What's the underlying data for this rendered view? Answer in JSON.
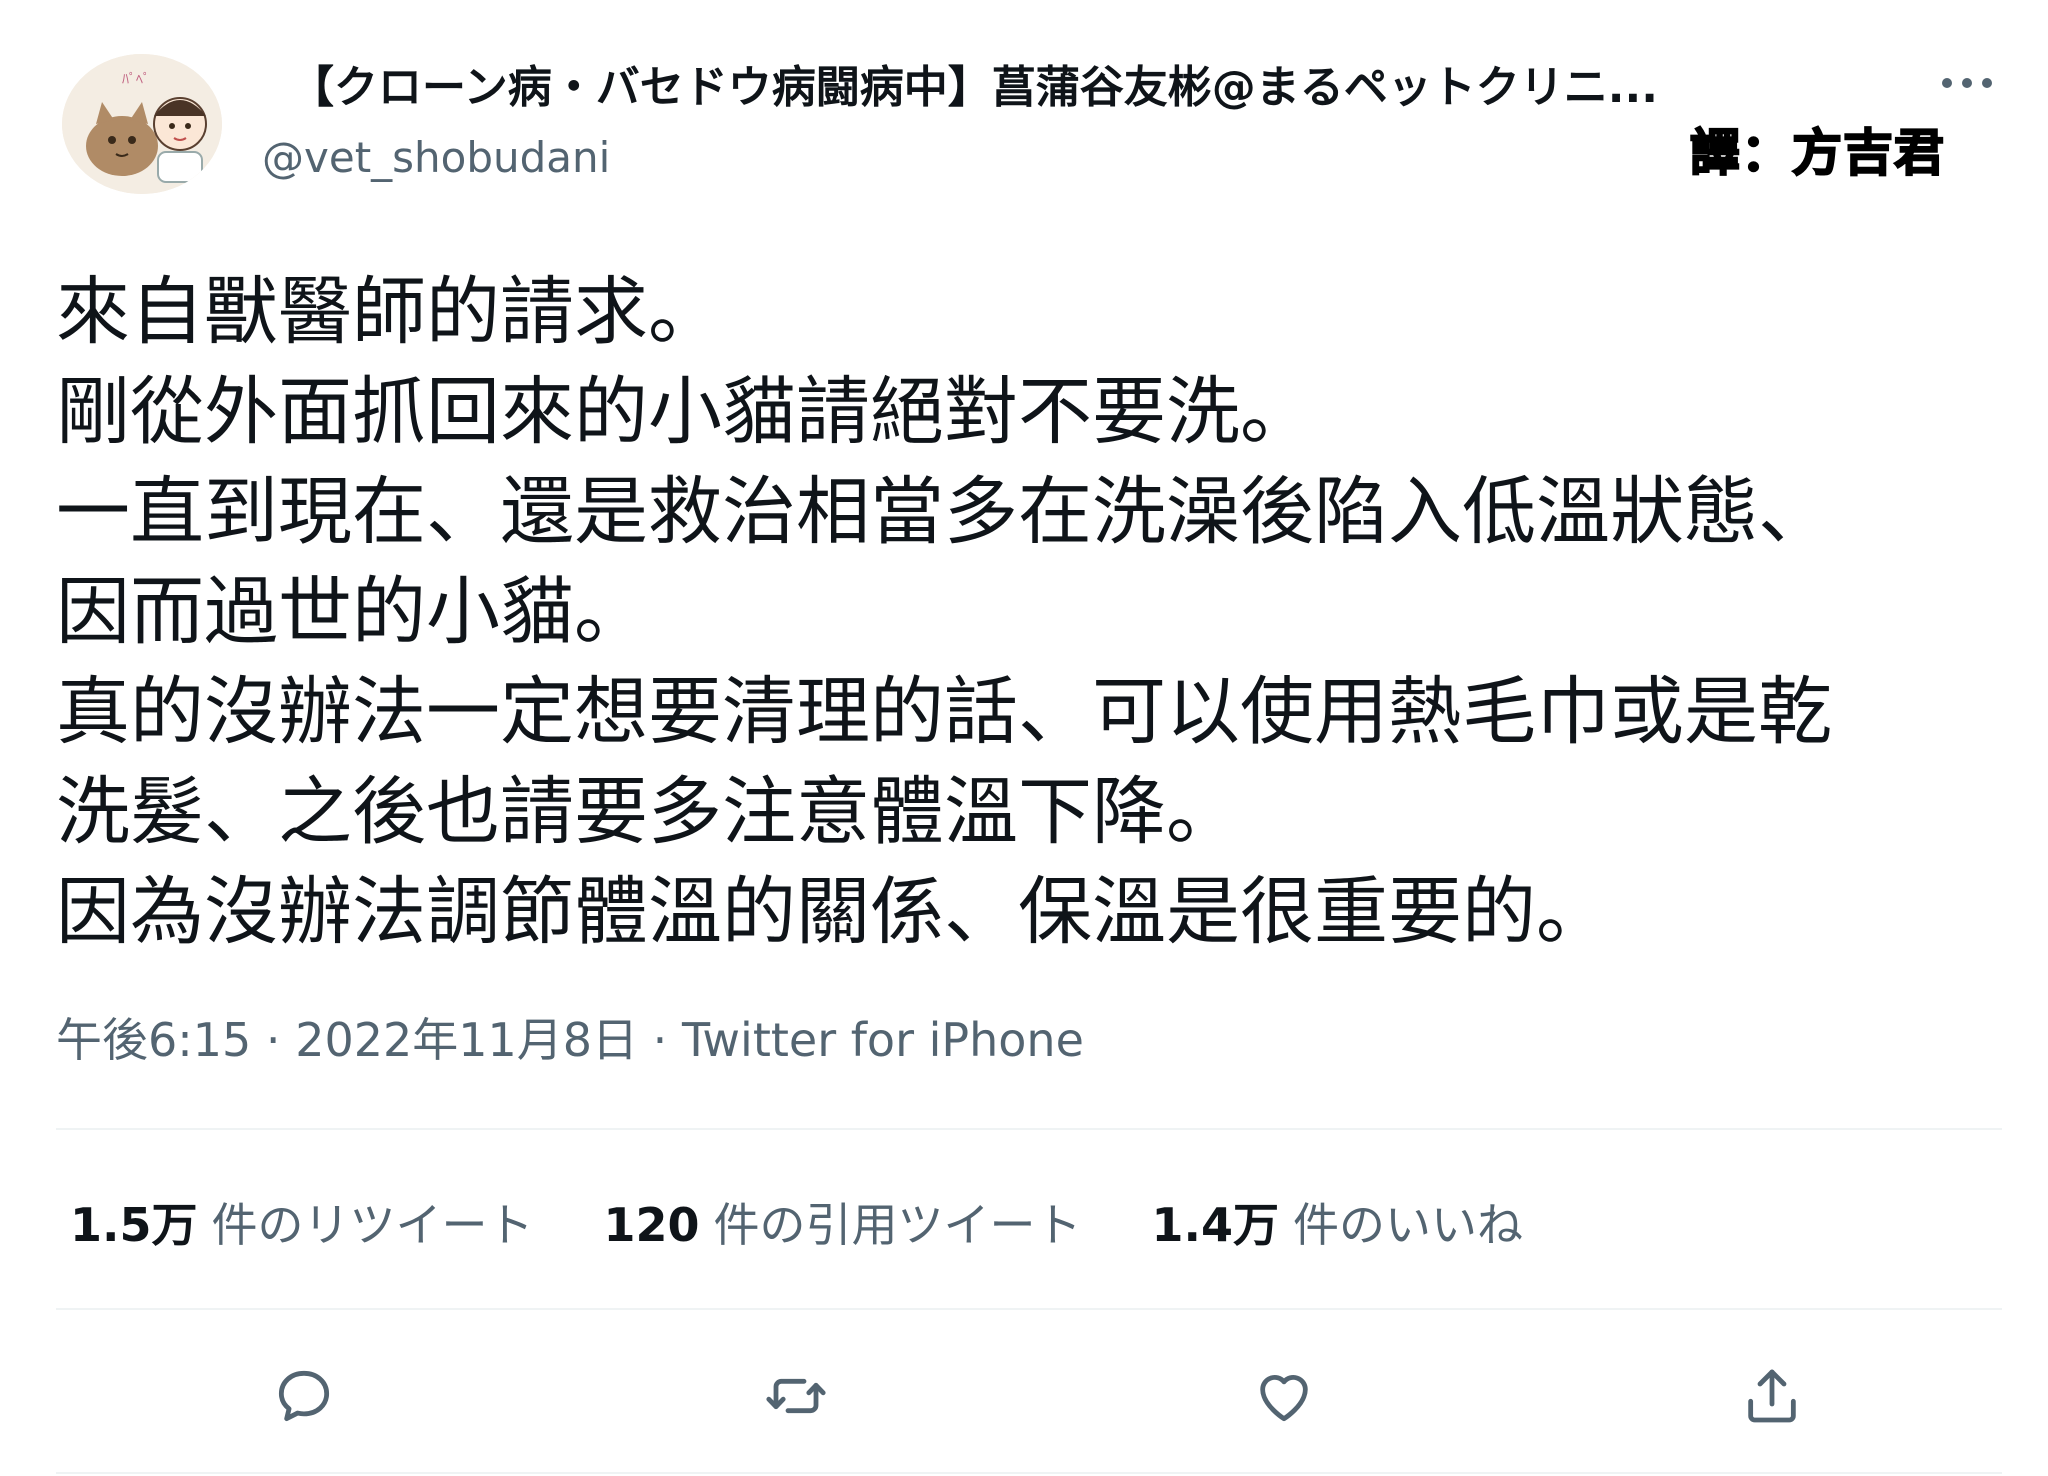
{
  "author": {
    "display_name": "【クローン病・バセドウ病闘病中】菖蒲谷友彬@まるペットクリニ...",
    "handle": "@vet_shobudani",
    "avatar_icon": "cat-doctor-avatar-icon"
  },
  "header": {
    "more_icon": "more-dots-icon",
    "watermark": "譯：方吉君"
  },
  "tweet": {
    "lines": [
      "來自獸醫師的請求。",
      "剛從外面抓回來的小貓請絕對不要洗。",
      "一直到現在、還是救治相當多在洗澡後陷入低溫狀態、",
      "因而過世的小貓。",
      "真的沒辦法一定想要清理的話、可以使用熱毛巾或是乾",
      "洗髮、之後也請要多注意體溫下降。",
      "因為沒辦法調節體溫的關係、保溫是很重要的。"
    ]
  },
  "meta": {
    "time": "午後6:15",
    "separator1": " · ",
    "date": "2022年11月8日",
    "separator2": " · ",
    "source": "Twitter for iPhone"
  },
  "stats": {
    "retweets": {
      "value": "1.5万",
      "label": "件のリツイート"
    },
    "quotes": {
      "value": "120",
      "label": "件の引用ツイート"
    },
    "likes": {
      "value": "1.4万",
      "label": "件のいいね"
    }
  },
  "actions": {
    "reply_icon": "reply-icon",
    "retweet_icon": "retweet-icon",
    "like_icon": "heart-icon",
    "share_icon": "share-icon"
  },
  "colors": {
    "text_primary": "#0f1419",
    "text_secondary": "#536471",
    "divider": "#eff3f4"
  }
}
